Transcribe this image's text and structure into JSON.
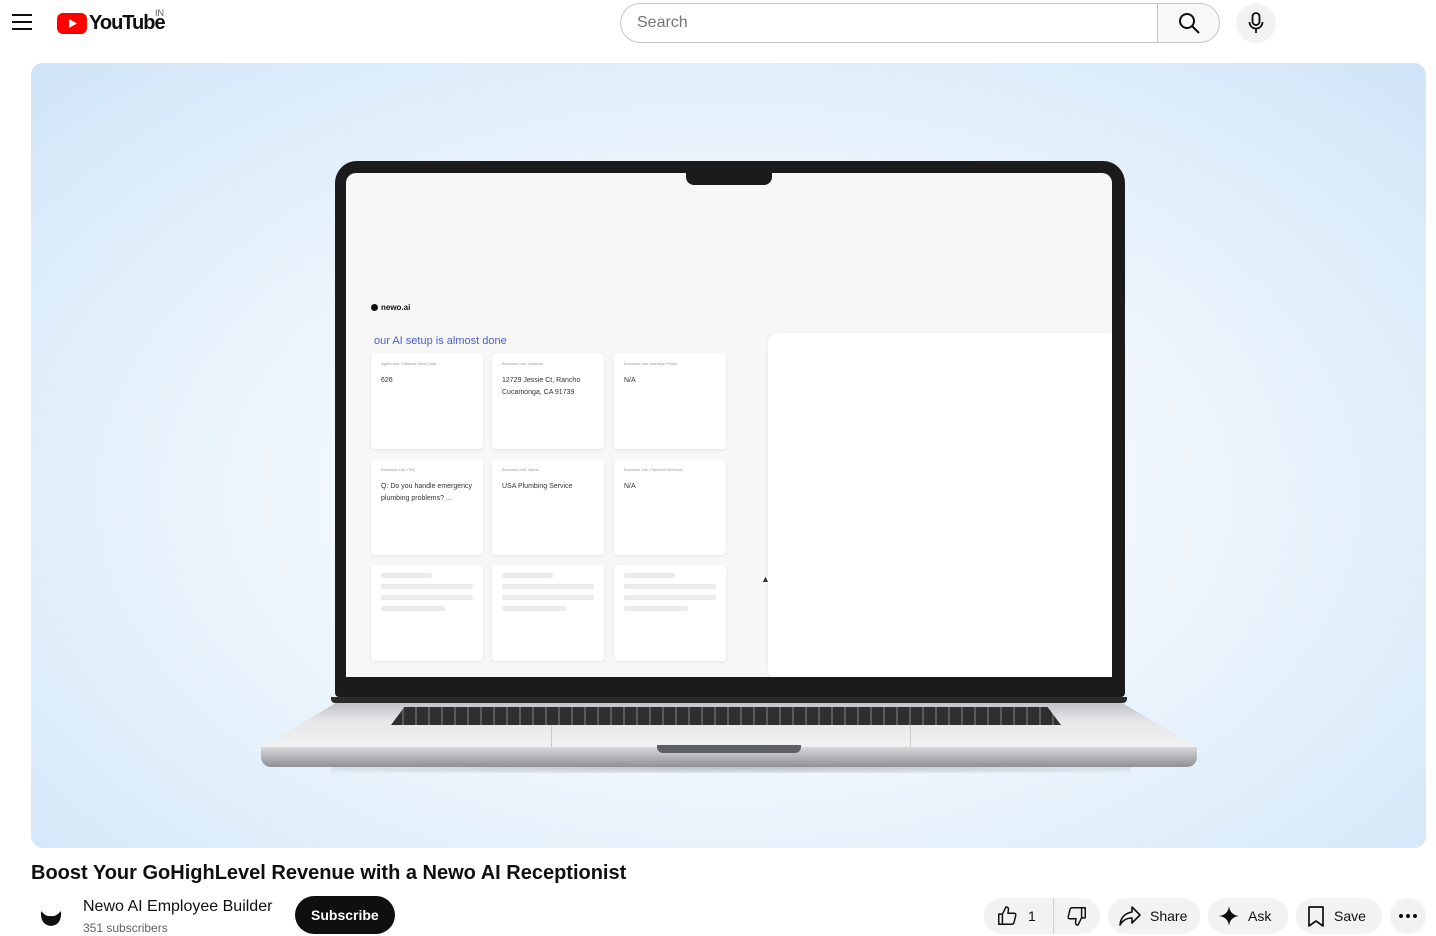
{
  "masthead": {
    "logo_text": "YouTube",
    "country_code": "IN",
    "search_placeholder": "Search"
  },
  "player": {
    "laptop_screen": {
      "app_logo": "newo.ai",
      "heading": "our AI setup is almost done",
      "cards": [
        {
          "label": "Agent Info: Fallback Area Code",
          "value": "626"
        },
        {
          "label": "Business Info: Address",
          "value": "12729 Jessie Ct, Rancho Cucamonga, CA 91739"
        },
        {
          "label": "Business Info: Average Prices",
          "value": "N/A"
        },
        {
          "label": "Business Info: FAQ",
          "value": "Q: Do you handle emergency plumbing problems? ..."
        },
        {
          "label": "Business Info: Name",
          "value": "USA Plumbing Service"
        },
        {
          "label": "Business Info: Payment Methods",
          "value": "N/A"
        }
      ]
    }
  },
  "video": {
    "title": "Boost Your GoHighLevel Revenue with a Newo AI Receptionist"
  },
  "owner": {
    "channel_name": "Newo AI Employee Builder",
    "subscribers": "351 subscribers",
    "subscribe_label": "Subscribe"
  },
  "actions": {
    "like_count": "1",
    "share_label": "Share",
    "ask_label": "Ask",
    "save_label": "Save"
  },
  "icons": {
    "menu": "hamburger-menu-icon",
    "search": "search-icon",
    "mic": "microphone-icon",
    "like": "thumbs-up-icon",
    "dislike": "thumbs-down-icon",
    "share": "share-arrow-icon",
    "ask": "sparkle-icon",
    "save": "bookmark-icon",
    "more": "more-horizontal-icon"
  },
  "colors": {
    "brand_red": "#ff0000",
    "subscribe_bg": "#0f0f0f",
    "pill_bg": "#f2f2f2",
    "accent_heading": "#4a5fd1"
  }
}
